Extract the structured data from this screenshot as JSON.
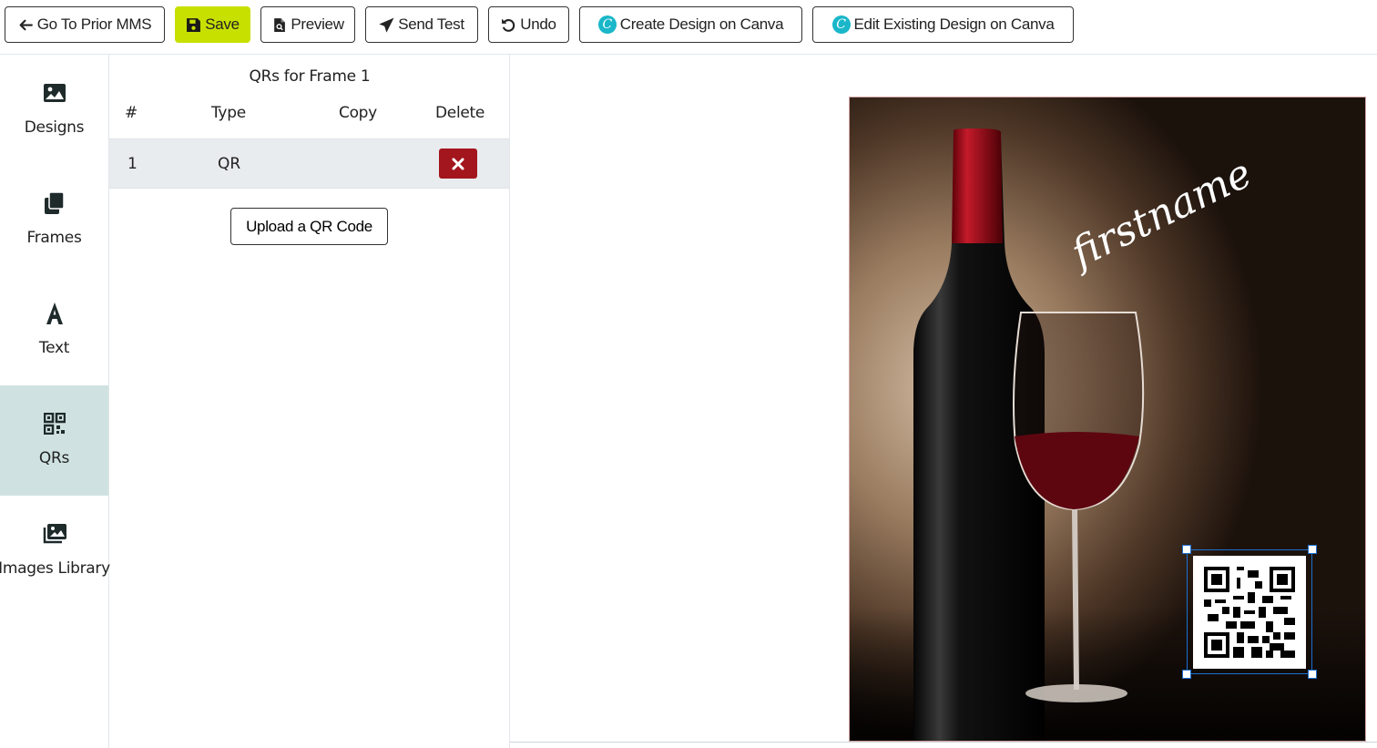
{
  "toolbar": {
    "back_label": "Go To Prior MMS",
    "save_label": "Save",
    "preview_label": "Preview",
    "send_test_label": "Send Test",
    "undo_label": "Undo",
    "create_canva_label": "Create Design on Canva",
    "edit_canva_label": "Edit Existing Design on Canva"
  },
  "sidebar": {
    "items": [
      {
        "label": "Designs",
        "icon": "image-icon"
      },
      {
        "label": "Frames",
        "icon": "frames-icon"
      },
      {
        "label": "Text",
        "icon": "text-icon"
      },
      {
        "label": "QRs",
        "icon": "qr-icon"
      },
      {
        "label": "Images Library",
        "icon": "images-library-icon"
      }
    ],
    "active": "QRs"
  },
  "panel": {
    "title": "QRs for Frame 1",
    "columns": [
      "#",
      "Type",
      "Copy",
      "Delete"
    ],
    "rows": [
      {
        "num": "1",
        "type": "QR",
        "copy": ""
      }
    ],
    "upload_label": "Upload a QR Code"
  },
  "canvas": {
    "overlay_text": "firstname"
  },
  "colors": {
    "save_accent": "#c8e000",
    "active_sidebar": "#cfe2e1",
    "delete_red": "#a3161e",
    "canva_teal": "#19b7c9",
    "selection_blue": "#1d6fd1"
  }
}
